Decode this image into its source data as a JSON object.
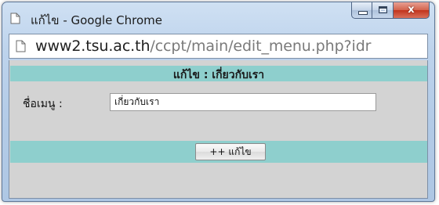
{
  "window": {
    "title": "แก้ไข - Google Chrome",
    "buttons": {
      "minimize": "minimize",
      "maximize": "maximize",
      "close": "x"
    }
  },
  "addressbar": {
    "host": "www2.tsu.ac.th",
    "path": "/ccpt/main/edit_menu.php?idr"
  },
  "page": {
    "header": "แก้ไข : เกี่ยวกับเรา",
    "form": {
      "menu_name_label": "ชื่อเมนู :",
      "menu_name_value": "เกี่ยวกับเรา"
    },
    "submit_label": "++ แก้ไข"
  },
  "colors": {
    "strip": "#8ecfcd",
    "page_bg": "#d3d3d3",
    "close_button": "#c1331c"
  },
  "icons": {
    "tab": "page-icon",
    "url": "page-icon"
  }
}
